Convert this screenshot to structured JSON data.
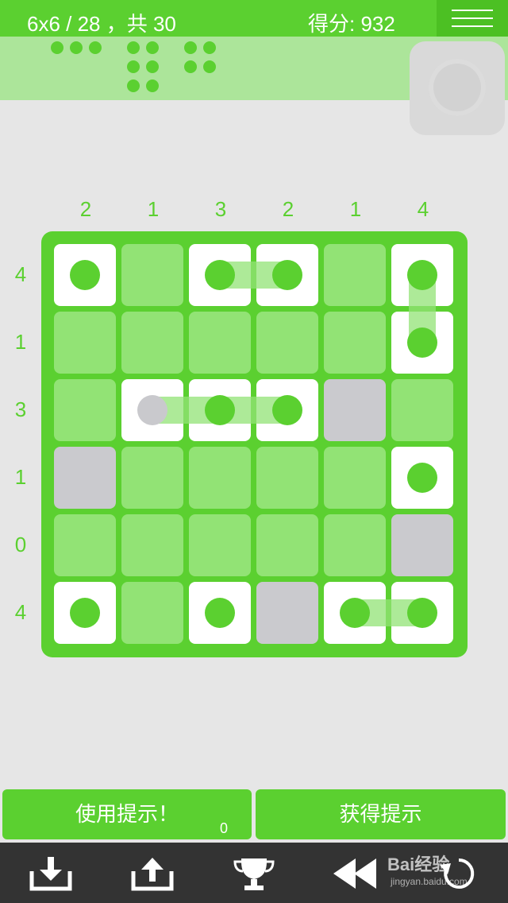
{
  "header": {
    "level_text": "6x6 / 28 ，共 30",
    "score_text": "得分: 932"
  },
  "pieces_bar": {
    "pieces": [
      "ship-3-horizontal",
      "ship-3-vertical-pair",
      "ship-2x2-dots"
    ]
  },
  "puzzle": {
    "size": 6,
    "column_clues": [
      "2",
      "1",
      "3",
      "2",
      "1",
      "4"
    ],
    "row_clues": [
      "4",
      "1",
      "3",
      "1",
      "0",
      "4"
    ],
    "grid_legend": {
      "S": "ship segment",
      "W": "water",
      ".": "unknown",
      "G": "hint segment"
    },
    "grid": [
      [
        "S",
        ".",
        "S",
        "S",
        ".",
        "S"
      ],
      [
        ".",
        ".",
        ".",
        ".",
        ".",
        "S"
      ],
      [
        ".",
        "G",
        "S",
        "S",
        "W",
        "."
      ],
      [
        "W",
        ".",
        ".",
        ".",
        ".",
        "S"
      ],
      [
        ".",
        ".",
        ".",
        ".",
        ".",
        "W"
      ],
      [
        "S",
        ".",
        "S",
        "W",
        "S",
        "S"
      ]
    ]
  },
  "actions": {
    "use_hint_label": "使用提示！",
    "hint_count": "0",
    "get_hints_label": "获得提示"
  },
  "toolbar": {
    "icons": [
      "download-icon",
      "upload-icon",
      "trophy-icon",
      "rewind-icon",
      "restart-icon"
    ]
  },
  "watermark": {
    "brand": "Bai经验",
    "url": "jingyan.baidu.com"
  },
  "colors": {
    "accent_green": "#5bd030",
    "light_green_cell": "#92e375",
    "water_gray": "#cacace",
    "background": "#e6e6e6",
    "bottom_bar": "#333333"
  }
}
